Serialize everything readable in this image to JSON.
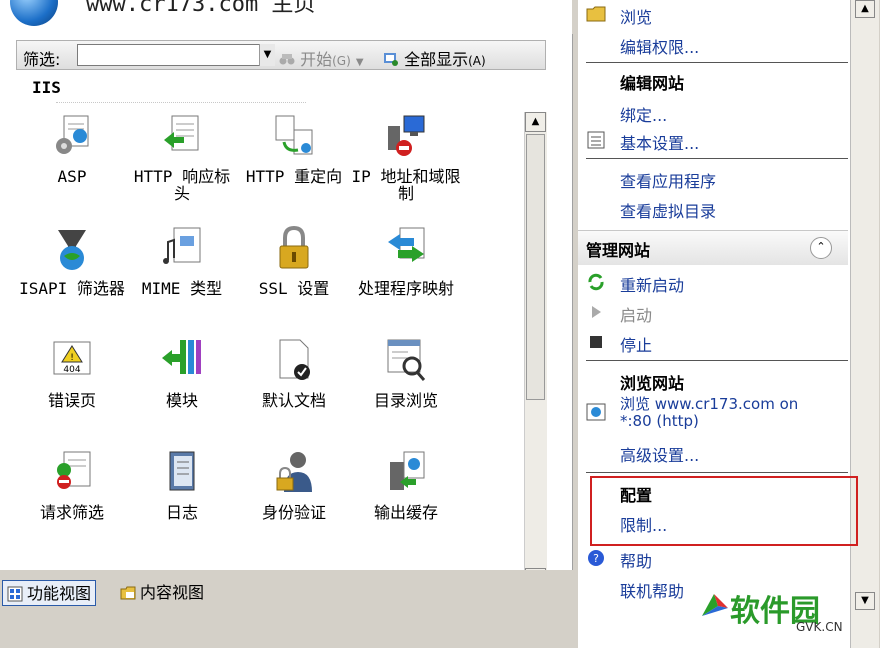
{
  "window": {
    "title": "www.cr173.com 主页"
  },
  "filter_bar": {
    "filter_label": "筛选:",
    "filter_value": "",
    "start_label": "开始",
    "start_shortcut": "(G)",
    "show_all_label": "全部显示",
    "show_all_shortcut": "(A)"
  },
  "group": {
    "title": "IIS"
  },
  "features": [
    {
      "label": "ASP",
      "icon": "asp-icon"
    },
    {
      "label": "HTTP 响应标头",
      "icon": "http-response-headers-icon"
    },
    {
      "label": "HTTP 重定向",
      "icon": "http-redirect-icon"
    },
    {
      "label": "IP 地址和域限制",
      "icon": "ip-restrictions-icon"
    },
    {
      "label": "ISAPI 筛选器",
      "icon": "isapi-filters-icon"
    },
    {
      "label": "MIME 类型",
      "icon": "mime-types-icon"
    },
    {
      "label": "SSL 设置",
      "icon": "ssl-lock-icon"
    },
    {
      "label": "处理程序映射",
      "icon": "handler-mappings-icon"
    },
    {
      "label": "错误页",
      "icon": "error-pages-404-icon"
    },
    {
      "label": "模块",
      "icon": "modules-icon"
    },
    {
      "label": "默认文档",
      "icon": "default-document-icon"
    },
    {
      "label": "目录浏览",
      "icon": "directory-browsing-icon"
    },
    {
      "label": "请求筛选",
      "icon": "request-filtering-icon"
    },
    {
      "label": "日志",
      "icon": "logging-icon"
    },
    {
      "label": "身份验证",
      "icon": "authentication-icon"
    },
    {
      "label": "输出缓存",
      "icon": "output-caching-icon"
    }
  ],
  "view_tabs": {
    "features_view": "功能视图",
    "content_view": "内容视图"
  },
  "actions": {
    "explore": "浏览",
    "edit_permissions": "编辑权限...",
    "edit_site_heading": "编辑网站",
    "bindings": "绑定...",
    "basic_settings": "基本设置...",
    "view_applications": "查看应用程序",
    "view_virtual_dirs": "查看虚拟目录",
    "manage_site_heading": "管理网站",
    "restart": "重新启动",
    "start": "启动",
    "stop": "停止",
    "browse_site_heading": "浏览网站",
    "browse_link_line1": "浏览 www.cr173.com on",
    "browse_link_line2": "*:80 (http)",
    "advanced_settings": "高级设置...",
    "config_heading": "配置",
    "limits": "限制...",
    "help": "帮助",
    "online_help": "联机帮助"
  },
  "watermark": {
    "text": "软件园",
    "url": "GVK.CN"
  },
  "colors": {
    "link": "#1a3d9a",
    "highlight_box": "#d02020",
    "disabled": "#8a8a8a"
  }
}
